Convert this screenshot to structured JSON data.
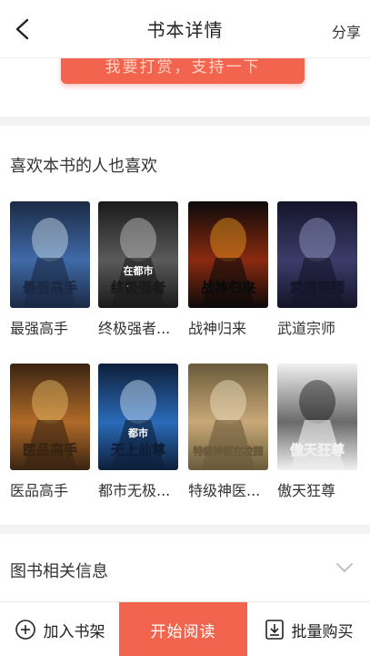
{
  "header": {
    "title": "书本详情",
    "share_label": "分享"
  },
  "reward": {
    "label": "我要打赏，支持一下"
  },
  "recommend": {
    "title": "喜欢本书的人也喜欢",
    "books": [
      {
        "name": "最强高手",
        "cover_text": "最强高手",
        "palette": [
          "#1b2a44",
          "#3f6aa8",
          "#d8e4f0"
        ]
      },
      {
        "name": "终极强者...",
        "cover_text": "终极强者",
        "cover_subtext": "在都市",
        "palette": [
          "#1a1a1a",
          "#5a5a5a",
          "#c9c9c9"
        ]
      },
      {
        "name": "战神归来",
        "cover_text": "战神归来",
        "palette": [
          "#0d0a0a",
          "#8a2a10",
          "#f2a020"
        ]
      },
      {
        "name": "武道宗师",
        "cover_text": "武道宗师",
        "palette": [
          "#14142a",
          "#3c3c6a",
          "#9aa0c8"
        ]
      },
      {
        "name": "医品高手",
        "cover_text": "医品高手",
        "palette": [
          "#3a2412",
          "#b06a28",
          "#f0c46a"
        ]
      },
      {
        "name": "都市无极...",
        "cover_text": "无上仙尊",
        "cover_subtext": "都市",
        "palette": [
          "#0e1f3a",
          "#2a6ab8",
          "#d8ecff"
        ]
      },
      {
        "name": "特级神医...",
        "cover_text": "特级神医在校园",
        "palette": [
          "#6a5a3a",
          "#c8a878",
          "#f4e6c8"
        ]
      },
      {
        "name": "傲天狂尊",
        "cover_text": "傲天狂尊",
        "palette": [
          "#f0f0f0",
          "#6a6a6a",
          "#111111"
        ]
      }
    ]
  },
  "info": {
    "label": "图书相关信息"
  },
  "bottom": {
    "add_shelf": "加入书架",
    "start_read": "开始阅读",
    "batch_buy": "批量购买"
  },
  "colors": {
    "accent": "#f2644e",
    "divider": "#f3f3f3"
  }
}
